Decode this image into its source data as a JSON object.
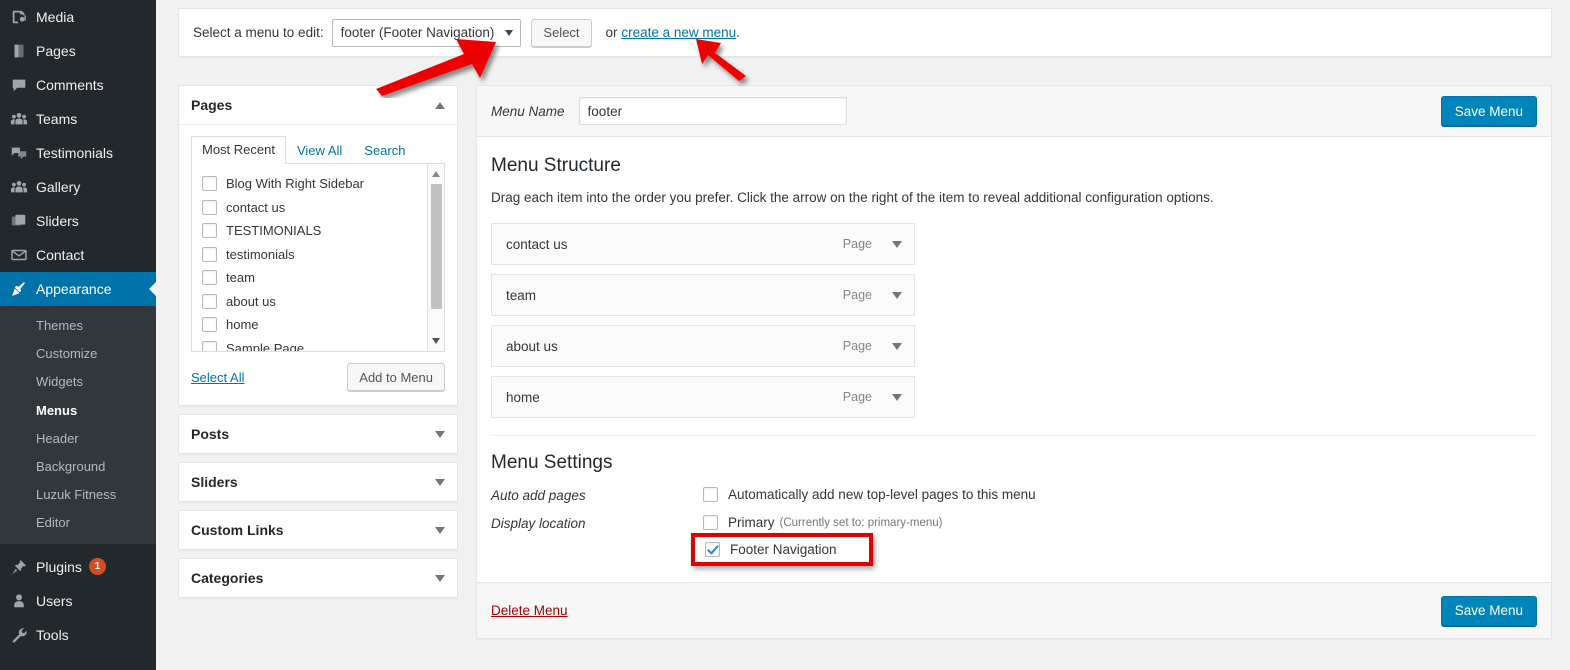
{
  "sidebar": {
    "items": [
      {
        "label": "Media",
        "icon": "media-icon",
        "type": "top"
      },
      {
        "label": "Pages",
        "icon": "pages-icon",
        "type": "top"
      },
      {
        "label": "Comments",
        "icon": "comments-icon",
        "type": "top"
      },
      {
        "label": "Teams",
        "icon": "teams-icon",
        "type": "top"
      },
      {
        "label": "Testimonials",
        "icon": "testimonials-icon",
        "type": "top"
      },
      {
        "label": "Gallery",
        "icon": "gallery-icon",
        "type": "top"
      },
      {
        "label": "Sliders",
        "icon": "sliders-icon",
        "type": "top"
      },
      {
        "label": "Contact",
        "icon": "contact-icon",
        "type": "top"
      },
      {
        "label": "Appearance",
        "icon": "appearance-icon",
        "type": "top",
        "current": true
      },
      {
        "label": "Plugins",
        "icon": "plugins-icon",
        "type": "top",
        "badge": "1"
      },
      {
        "label": "Users",
        "icon": "users-icon",
        "type": "top"
      },
      {
        "label": "Tools",
        "icon": "tools-icon",
        "type": "top"
      }
    ],
    "appearance_submenu": [
      {
        "label": "Themes"
      },
      {
        "label": "Customize"
      },
      {
        "label": "Widgets"
      },
      {
        "label": "Menus",
        "active": true
      },
      {
        "label": "Header"
      },
      {
        "label": "Background"
      },
      {
        "label": "Luzuk Fitness"
      },
      {
        "label": "Editor"
      }
    ]
  },
  "menu_select_bar": {
    "label": "Select a menu to edit:",
    "selected_menu": "footer (Footer Navigation)",
    "select_button": "Select",
    "or_text": "or",
    "create_link": "create a new menu",
    "period": "."
  },
  "pages_panel": {
    "title": "Pages",
    "tabs": [
      {
        "label": "Most Recent",
        "active": true
      },
      {
        "label": "View All",
        "active": false
      },
      {
        "label": "Search",
        "active": false
      }
    ],
    "items": [
      {
        "label": "Blog With Right Sidebar",
        "checked": false
      },
      {
        "label": "contact us",
        "checked": false
      },
      {
        "label": "TESTIMONIALS",
        "checked": false
      },
      {
        "label": "testimonials",
        "checked": false
      },
      {
        "label": "team",
        "checked": false
      },
      {
        "label": "about us",
        "checked": false
      },
      {
        "label": "home",
        "checked": false
      },
      {
        "label": "Sample Page",
        "checked": false
      }
    ],
    "select_all": "Select All",
    "add_to_menu": "Add to Menu"
  },
  "accordion": [
    {
      "title": "Posts"
    },
    {
      "title": "Sliders"
    },
    {
      "title": "Custom Links"
    },
    {
      "title": "Categories"
    }
  ],
  "menu_editor": {
    "name_label": "Menu Name",
    "name_value": "footer",
    "name_placeholder": "Menu Name",
    "save_top": "Save Menu",
    "save_bottom": "Save Menu",
    "structure_heading": "Menu Structure",
    "structure_desc": "Drag each item into the order you prefer. Click the arrow on the right of the item to reveal additional configuration options.",
    "items": [
      {
        "title": "contact us",
        "type": "Page"
      },
      {
        "title": "team",
        "type": "Page"
      },
      {
        "title": "about us",
        "type": "Page"
      },
      {
        "title": "home",
        "type": "Page"
      }
    ],
    "settings_heading": "Menu Settings",
    "auto_add_label": "Auto add pages",
    "auto_add_option": "Automatically add new top-level pages to this menu",
    "auto_add_checked": false,
    "display_location_label": "Display location",
    "locations": [
      {
        "label": "Primary",
        "note": "(Currently set to: primary-menu)",
        "checked": false,
        "highlighted": false
      },
      {
        "label": "Footer Navigation",
        "note": "",
        "checked": true,
        "highlighted": true
      }
    ],
    "delete_link": "Delete Menu"
  },
  "colors": {
    "accent": "#0073aa",
    "button_primary": "#0085ba",
    "annotation_red": "#e00000",
    "sidebar_bg": "#23282d",
    "submenu_bg": "#32373c",
    "badge": "#d54e21",
    "delete_red": "#a00000"
  },
  "annotations": [
    {
      "name": "arrow-to-menu-dropdown",
      "direction": "up-right"
    },
    {
      "name": "arrow-to-create-new-menu",
      "direction": "up-left"
    },
    {
      "name": "footer-navigation-highlight-box",
      "shape": "rectangle"
    }
  ]
}
